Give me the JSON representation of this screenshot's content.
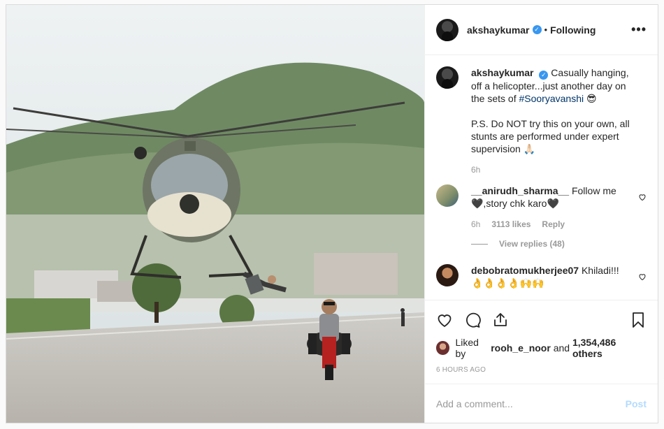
{
  "header": {
    "username": "akshaykumar",
    "separator": "•",
    "follow_status": "Following",
    "more_label": "•••"
  },
  "caption": {
    "username": "akshaykumar",
    "text_before": "Casually hanging, off a helicopter...just another day on the sets of ",
    "hashtag": "#Sooryavanshi",
    "emoji": "😎",
    "text_ps": "P.S. Do NOT try this on your own, all stunts are performed under expert supervision 🙏🏻",
    "time": "6h"
  },
  "comments": [
    {
      "username": "__anirudh_sharma__",
      "text": "Follow me 🖤,story chk karo🖤",
      "time": "6h",
      "likes": "3113 likes",
      "reply_label": "Reply",
      "view_replies": "View replies (48)"
    },
    {
      "username": "debobratomukherjee07",
      "text": "Khiladi!!! 👌👌👌👌🙌🙌"
    }
  ],
  "likes": {
    "prefix": "Liked by ",
    "user": "rooh_e_noor",
    "middle": " and ",
    "count": "1,354,486 others"
  },
  "timestamp": "6 HOURS AGO",
  "add_comment": {
    "placeholder": "Add a comment...",
    "post_label": "Post"
  },
  "icons": {
    "like": "heart-icon",
    "comment": "comment-icon",
    "share": "share-icon",
    "save": "bookmark-icon"
  },
  "colors": {
    "verified": "#3897f0",
    "hashtag": "#003569",
    "post_disabled": "#b3dbff",
    "muted": "#999999"
  }
}
